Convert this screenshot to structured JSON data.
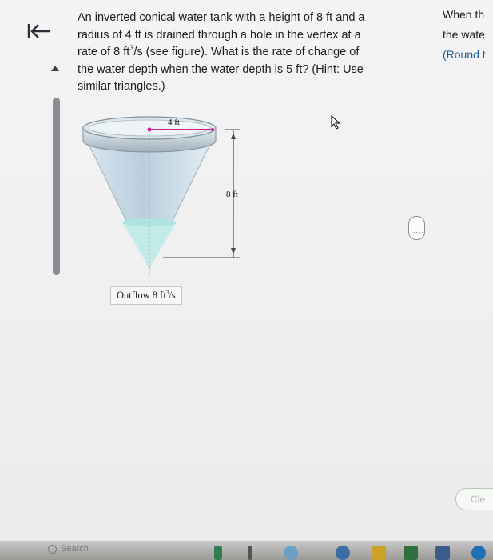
{
  "nav": {
    "back_icon": "collapse-left-arrow-icon"
  },
  "question": {
    "line1": "An inverted conical water tank with a height of 8 ft and a",
    "line2": "radius of 4 ft is drained through a hole in the vertex at a",
    "line3_prefix": "rate of 8 ft",
    "line3_sup": "3",
    "line3_suffix": "/s (see figure). What is the rate of change of",
    "line4": "the water depth when the water depth is 5 ft? (Hint: Use",
    "line5": "similar triangles.)"
  },
  "figure": {
    "radius_label": "4 ft",
    "height_label": "8 ft",
    "outflow_prefix": "Outflow 8 ft",
    "outflow_sup": "3",
    "outflow_suffix": "/s",
    "colors": {
      "tank_fill": "#c9dde9",
      "water": "#c2ecea",
      "radius_line": "#d0209a",
      "dim_line": "#444444"
    }
  },
  "answer_panel": {
    "line1": "When th",
    "line2": "the wate",
    "line3": "(Round t"
  },
  "divider_handle": {
    "label": "...."
  },
  "clear_button": {
    "label": "Cle"
  },
  "taskbar": {
    "search_label": "Search"
  },
  "colors": {
    "accent_blue": "#1f5b9a",
    "scrollbar": "#8a8d93"
  }
}
